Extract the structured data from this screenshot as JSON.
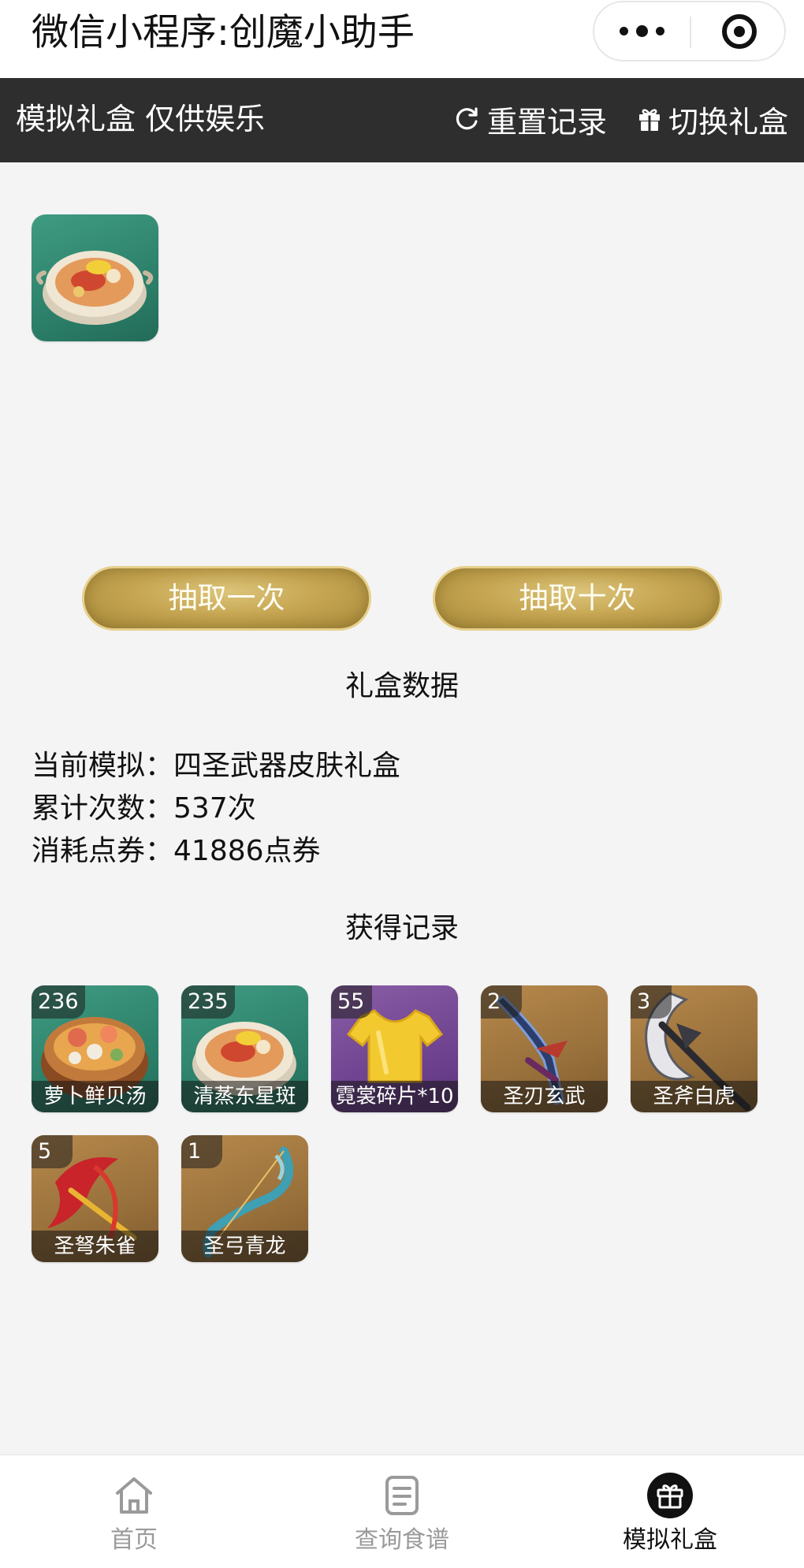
{
  "window": {
    "title": "微信小程序:创魔小助手"
  },
  "header": {
    "title": "模拟礼盒 仅供娱乐",
    "reset_label": "重置记录",
    "switch_label": "切换礼盒"
  },
  "preview": {
    "item_icon": "fish-stew-icon"
  },
  "actions": {
    "draw_once_label": "抽取一次",
    "draw_ten_label": "抽取十次"
  },
  "stats": {
    "section_title": "礼盒数据",
    "current_label": "当前模拟：",
    "current_value": "四圣武器皮肤礼盒",
    "count_label": "累计次数：",
    "count_value": "537次",
    "cost_label": "消耗点券：",
    "cost_value": "41886点券"
  },
  "records": {
    "section_title": "获得记录",
    "items": [
      {
        "count": "236",
        "name": "萝卜鲜贝汤",
        "icon": "seafood-soup-icon"
      },
      {
        "count": "235",
        "name": "清蒸东星斑",
        "icon": "fish-stew-icon"
      },
      {
        "count": "55",
        "name": "霓裳碎片*10",
        "icon": "shirt-icon"
      },
      {
        "count": "2",
        "name": "圣刃玄武",
        "icon": "blade-icon"
      },
      {
        "count": "3",
        "name": "圣斧白虎",
        "icon": "axe-icon"
      },
      {
        "count": "5",
        "name": "圣弩朱雀",
        "icon": "crossbow-icon"
      },
      {
        "count": "1",
        "name": "圣弓青龙",
        "icon": "bow-icon"
      }
    ]
  },
  "tabbar": {
    "items": [
      {
        "label": "首页",
        "icon": "home-icon",
        "active": false
      },
      {
        "label": "查询食谱",
        "icon": "document-icon",
        "active": false
      },
      {
        "label": "模拟礼盒",
        "icon": "gift-icon",
        "active": true
      }
    ]
  }
}
